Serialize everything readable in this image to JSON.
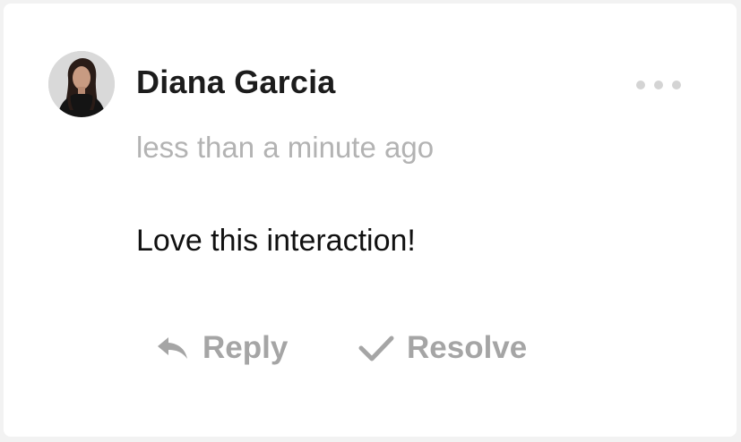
{
  "comment": {
    "author": "Diana Garcia",
    "timestamp": "less than a minute ago",
    "body": "Love this interaction!",
    "avatar_alt": "Diana Garcia avatar"
  },
  "menu": {
    "icon": "more-horizontal-icon"
  },
  "actions": {
    "reply_label": "Reply",
    "reply_icon": "reply-arrow-icon",
    "resolve_label": "Resolve",
    "resolve_icon": "checkmark-icon"
  },
  "colors": {
    "author_text": "#1c1c1c",
    "muted_text": "#b3b3b3",
    "action_text": "#a5a5a5",
    "body_text": "#111111"
  }
}
